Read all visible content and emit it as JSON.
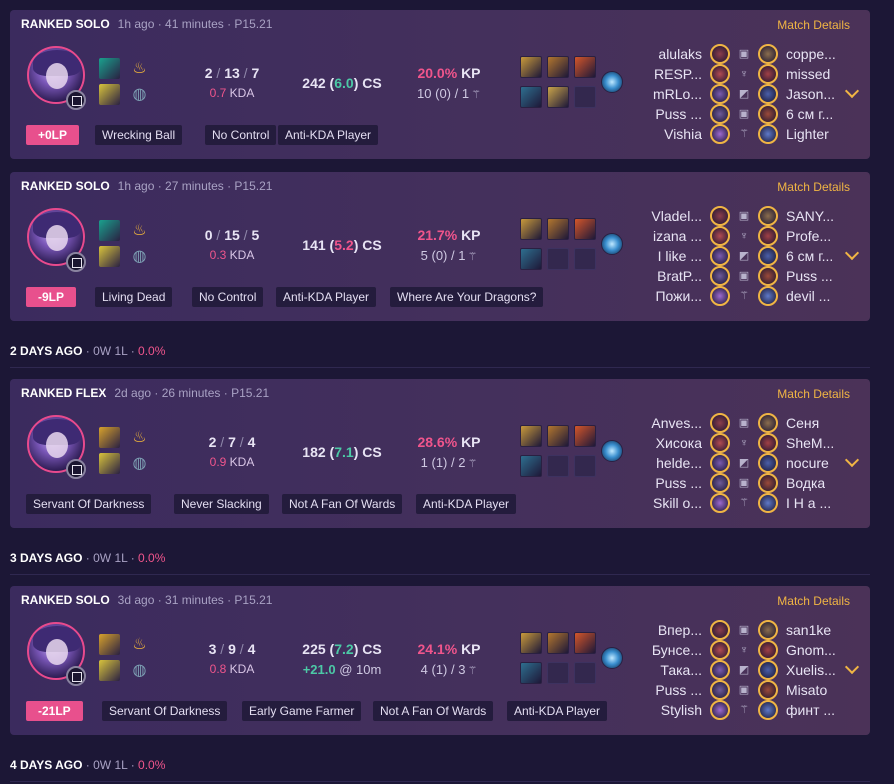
{
  "match_details_label": "Match Details",
  "day_groups": [
    {
      "label": "2 DAYS AGO",
      "record": " · 0W 1L · ",
      "winrate": "0.0%"
    },
    {
      "label": "3 DAYS AGO",
      "record": " · 0W 1L · ",
      "winrate": "0.0%"
    },
    {
      "label": "4 DAYS AGO",
      "record": " · 0W 1L · ",
      "winrate": "0.0%"
    }
  ],
  "matches": [
    {
      "queue": "RANKED SOLO",
      "time_ago": "1h ago",
      "duration": "41 minutes",
      "patch": "P15.21",
      "kills": "2",
      "deaths": "13",
      "assists": "7",
      "kda_ratio": "0.7",
      "kda_label": "KDA",
      "cs": "242",
      "cs_per_min": "6.0",
      "cs_label": "CS",
      "cs_diff": "",
      "cs_diff_at": "",
      "kp": "20.0%",
      "kp_label": "KP",
      "wards": "10 (0) / 1",
      "lp": "+0LP",
      "tags": [
        "Wrecking Ball",
        "No Control",
        "Anti-KDA Player"
      ],
      "spells": [
        "teleport-spell",
        "flash-spell"
      ],
      "runes": [
        "domination-primary-rune",
        "resolve-secondary-rune"
      ],
      "items": [
        "item-1",
        "item-2",
        "item-3",
        "item-4",
        "item-5",
        "empty"
      ],
      "blue_team": [
        "alulaks",
        "RESP...",
        "mRLo...",
        "Puss ...",
        "Vishia"
      ],
      "red_team": [
        "coppe...",
        "missed",
        "Jason...",
        "6 см г...",
        "Lighter"
      ]
    },
    {
      "queue": "RANKED SOLO",
      "time_ago": "1h ago",
      "duration": "27 minutes",
      "patch": "P15.21",
      "kills": "0",
      "deaths": "15",
      "assists": "5",
      "kda_ratio": "0.3",
      "kda_label": "KDA",
      "cs": "141",
      "cs_per_min": "5.2",
      "cs_label": "CS",
      "cs_diff": "",
      "cs_diff_at": "",
      "kp": "21.7%",
      "kp_label": "KP",
      "wards": "5 (0) / 1",
      "lp": "-9LP",
      "tags": [
        "Living Dead",
        "No Control",
        "Anti-KDA Player",
        "Where Are Your Dragons?"
      ],
      "spells": [
        "teleport-spell",
        "flash-spell"
      ],
      "runes": [
        "domination-primary-rune",
        "resolve-secondary-rune"
      ],
      "items": [
        "item-1",
        "item-2",
        "item-3",
        "item-4",
        "empty",
        "empty"
      ],
      "blue_team": [
        "Vladel...",
        "izana ...",
        "I like ...",
        "BratP...",
        "Пожи..."
      ],
      "red_team": [
        "SANY...",
        "Profe...",
        "6 см г...",
        "Puss ...",
        "devil ..."
      ]
    },
    {
      "queue": "RANKED FLEX",
      "time_ago": "2d ago",
      "duration": "26 minutes",
      "patch": "P15.21",
      "kills": "2",
      "deaths": "7",
      "assists": "4",
      "kda_ratio": "0.9",
      "kda_label": "KDA",
      "cs": "182",
      "cs_per_min": "7.1",
      "cs_label": "CS",
      "cs_diff": "",
      "cs_diff_at": "",
      "kp": "28.6%",
      "kp_label": "KP",
      "wards": "1 (1) / 2",
      "lp": "",
      "tags": [
        "Servant Of Darkness",
        "Never Slacking",
        "Not A Fan Of Wards",
        "Anti-KDA Player"
      ],
      "spells": [
        "ignite-spell",
        "flash-spell"
      ],
      "runes": [
        "domination-primary-rune",
        "resolve-secondary-rune"
      ],
      "items": [
        "item-1",
        "item-2",
        "item-3",
        "item-4",
        "empty",
        "empty"
      ],
      "blue_team": [
        "Anves...",
        "Хисока",
        "helde...",
        "Puss ...",
        "Skill o..."
      ],
      "red_team": [
        "Сеня",
        "SheM...",
        "nocure",
        "Водка",
        "I H a ..."
      ]
    },
    {
      "queue": "RANKED SOLO",
      "time_ago": "3d ago",
      "duration": "31 minutes",
      "patch": "P15.21",
      "kills": "3",
      "deaths": "9",
      "assists": "4",
      "kda_ratio": "0.8",
      "kda_label": "KDA",
      "cs": "225",
      "cs_per_min": "7.2",
      "cs_label": "CS",
      "cs_diff": "+21.0",
      "cs_diff_at": " @ 10m",
      "kp": "24.1%",
      "kp_label": "KP",
      "wards": "4 (1) / 3",
      "lp": "-21LP",
      "tags": [
        "Servant Of Darkness",
        "Early Game Farmer",
        "Not A Fan Of Wards",
        "Anti-KDA Player"
      ],
      "spells": [
        "ignite-spell",
        "flash-spell"
      ],
      "runes": [
        "domination-primary-rune",
        "resolve-secondary-rune"
      ],
      "items": [
        "item-1",
        "item-2",
        "item-3",
        "item-4",
        "empty",
        "empty"
      ],
      "blue_team": [
        "Впер...",
        "Бунсе...",
        "Така...",
        "Puss ...",
        "Stylish"
      ],
      "red_team": [
        "san1ke",
        "Gnom...",
        "Xuelis...",
        "Misato",
        "финт ..."
      ]
    }
  ],
  "colors": {
    "accent_gold": "#f0b544",
    "loss_pink": "#e8508d",
    "good_green": "#4cc9a6",
    "card_bg": "#3b2b5e",
    "page_bg": "#1c1736"
  }
}
